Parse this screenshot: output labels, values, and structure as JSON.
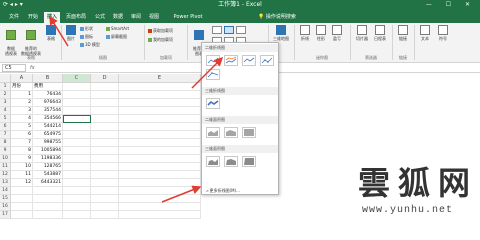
{
  "window": {
    "title": "工作簿1 - Excel",
    "qat": "⟳ ◂ ▸ ▾",
    "controls": "— ☐ ✕"
  },
  "tabs": [
    {
      "label": "文件"
    },
    {
      "label": "开始"
    },
    {
      "label": "插入"
    },
    {
      "label": "页面布局"
    },
    {
      "label": "公式"
    },
    {
      "label": "数据"
    },
    {
      "label": "审阅"
    },
    {
      "label": "视图"
    },
    {
      "label": "Power Pivot"
    }
  ],
  "tab_search": "操作说明搜索",
  "ribbon": {
    "pivot_table": "数据\n透视表",
    "recommended_pivot": "推荐的\n数据透视表",
    "table": "表格",
    "picture": "图片",
    "shapes": "形状",
    "icons": "图标",
    "smartart": "SmartArt",
    "screenshot": "屏幕截图",
    "models_3d": "3D 模型",
    "get_addins": "获取加载项",
    "my_addins": "我的加载项",
    "recommended_charts": "推荐的\n图表",
    "maps": "三维地图",
    "sparkline_line": "折线",
    "sparkline_column": "柱形",
    "sparkline_winloss": "盈亏",
    "slicer": "切片器",
    "timeline": "日程表",
    "link": "链接",
    "text": "文本",
    "symbol": "符号",
    "groups": {
      "tables": "表格",
      "illustrations": "插图",
      "addins": "加载项",
      "sparklines": "迷你图",
      "filters": "筛选器",
      "links": "链接"
    }
  },
  "formula_bar": {
    "name_box": "C5",
    "fx": "fx"
  },
  "columns": [
    "A",
    "B",
    "C",
    "D",
    "E"
  ],
  "rows": [
    {
      "n": "1",
      "a": "月份",
      "b": "费用"
    },
    {
      "n": "2",
      "a": "1",
      "b": "76434"
    },
    {
      "n": "3",
      "a": "2",
      "b": "976643"
    },
    {
      "n": "4",
      "a": "3",
      "b": "357544"
    },
    {
      "n": "5",
      "a": "4",
      "b": "354566"
    },
    {
      "n": "6",
      "a": "5",
      "b": "544214"
    },
    {
      "n": "7",
      "a": "6",
      "b": "654975"
    },
    {
      "n": "8",
      "a": "7",
      "b": "998755"
    },
    {
      "n": "9",
      "a": "8",
      "b": "1005894"
    },
    {
      "n": "10",
      "a": "9",
      "b": "1198336"
    },
    {
      "n": "11",
      "a": "10",
      "b": "128765"
    },
    {
      "n": "12",
      "a": "11",
      "b": "543887"
    },
    {
      "n": "13",
      "a": "12",
      "b": "6443321"
    },
    {
      "n": "14",
      "a": "",
      "b": ""
    },
    {
      "n": "15",
      "a": "",
      "b": ""
    },
    {
      "n": "16",
      "a": "",
      "b": ""
    },
    {
      "n": "17",
      "a": "",
      "b": ""
    }
  ],
  "dropdown": {
    "section_2d_line": "二维折线图",
    "section_3d_line": "三维折线图",
    "section_2d_area": "二维面积图",
    "section_3d_area": "三维面积图",
    "more_link": "更多折线图(M)..."
  },
  "watermark": {
    "title": "雲狐网",
    "url": "www.yunhu.net"
  },
  "colors": {
    "excel_green": "#217346",
    "arrow_red": "#e03c31"
  }
}
